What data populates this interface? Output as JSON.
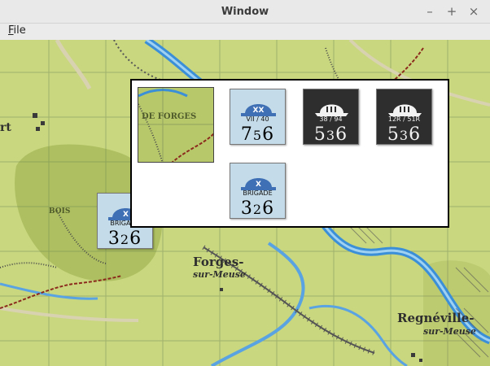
{
  "window": {
    "title": "Window",
    "controls": {
      "minimize": "–",
      "maximize": "+",
      "close": "×"
    }
  },
  "menu": {
    "file_mnemonic": "F",
    "file_rest": "ile"
  },
  "map": {
    "labels": {
      "art": "rt",
      "de_forges": "DE FORGES",
      "bois": "BOIS",
      "forges": "Forges-",
      "sur_meuse": "sur-Meuse",
      "regneville": "Regnéville-",
      "regneville_sur": "sur-Meuse"
    },
    "map_counter": {
      "unit": "BRIGADE",
      "attack": "3",
      "defense": "2",
      "move": "6"
    }
  },
  "popup": {
    "terrain_label": "DE FORGES",
    "counters": [
      {
        "side": "french",
        "unit": "VII / 40",
        "attack": "7",
        "defense": "5",
        "move": "6"
      },
      {
        "side": "german",
        "unit": "38 / 94",
        "attack": "5",
        "defense": "3",
        "move": "6"
      },
      {
        "side": "german",
        "unit": "12R / 51R",
        "attack": "5",
        "defense": "3",
        "move": "6"
      },
      {
        "side": "french",
        "unit": "BRIGADE",
        "attack": "3",
        "defense": "2",
        "move": "6"
      }
    ]
  }
}
